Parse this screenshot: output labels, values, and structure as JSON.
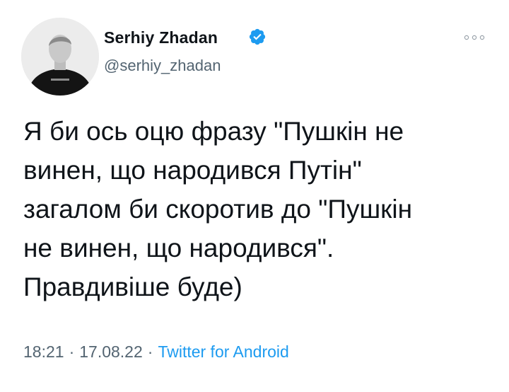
{
  "tweet": {
    "author": {
      "display_name": "Serhiy Zhadan",
      "handle": "@serhiy_zhadan",
      "verified": true,
      "avatar_icon": "profile-photo"
    },
    "text": "Я би ось оцю фразу \"Пушкін не\nвинен, що народився Путін\"\nзагалом би скоротив до \"Пушкін\nне винен, що народився\".\nПравдивіше буде)",
    "time": "18:21",
    "date": "17.08.22",
    "separator": "·",
    "source": "Twitter for Android",
    "more_icon": "more-horizontal-icon"
  },
  "colors": {
    "text_primary": "#0f1419",
    "text_secondary": "#536471",
    "accent_blue": "#1d9bf0",
    "background": "#ffffff"
  }
}
